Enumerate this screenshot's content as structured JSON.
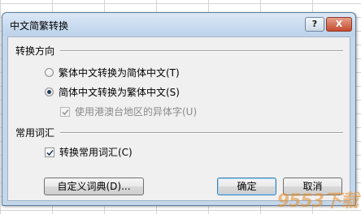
{
  "dialog": {
    "title": "中文简繁转换",
    "help_label": "?",
    "close_label": "X"
  },
  "direction_group": {
    "title": "转换方向",
    "options": [
      {
        "label": "繁体中文转换为简体中文(T)",
        "selected": false
      },
      {
        "label": "简体中文转换为繁体中文(S)",
        "selected": true
      }
    ],
    "sub_option": {
      "label": "使用港澳台地区的异体字(U)",
      "checked": true,
      "enabled": false
    }
  },
  "vocab_group": {
    "title": "常用词汇",
    "option": {
      "label": "转换常用词汇(C)",
      "checked": true
    }
  },
  "buttons": {
    "custom_dict": "自定义词典(D)...",
    "ok": "确定",
    "cancel": "取消"
  },
  "watermark": "9553下载"
}
